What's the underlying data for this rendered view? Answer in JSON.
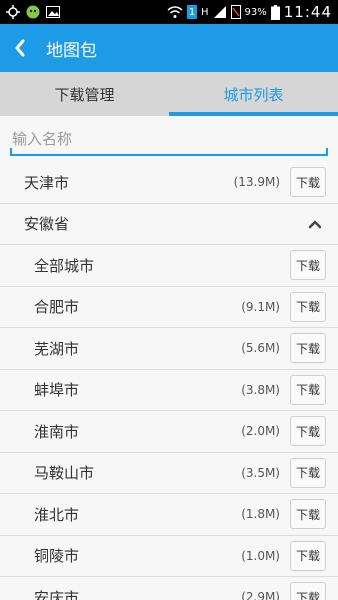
{
  "statusbar": {
    "time": "11:44",
    "battery_percent": "93%",
    "signal_label": "H",
    "sim_badge": "1"
  },
  "appbar": {
    "title": "地图包"
  },
  "tabs": [
    {
      "label": "下载管理",
      "active": false
    },
    {
      "label": "城市列表",
      "active": true
    }
  ],
  "search": {
    "placeholder": "输入名称",
    "value": ""
  },
  "list": {
    "download_label": "下载",
    "items": [
      {
        "name": "天津市",
        "size": "(13.9M)",
        "kind": "top"
      },
      {
        "name": "安徽省",
        "kind": "province",
        "expanded": true
      },
      {
        "name": "全部城市",
        "kind": "city",
        "size": ""
      },
      {
        "name": "合肥市",
        "kind": "city",
        "size": "(9.1M)"
      },
      {
        "name": "芜湖市",
        "kind": "city",
        "size": "(5.6M)"
      },
      {
        "name": "蚌埠市",
        "kind": "city",
        "size": "(3.8M)"
      },
      {
        "name": "淮南市",
        "kind": "city",
        "size": "(2.0M)"
      },
      {
        "name": "马鞍山市",
        "kind": "city",
        "size": "(3.5M)"
      },
      {
        "name": "淮北市",
        "kind": "city",
        "size": "(1.8M)"
      },
      {
        "name": "铜陵市",
        "kind": "city",
        "size": "(1.0M)"
      },
      {
        "name": "安庆市",
        "kind": "city",
        "size": "(2.9M)"
      }
    ]
  }
}
